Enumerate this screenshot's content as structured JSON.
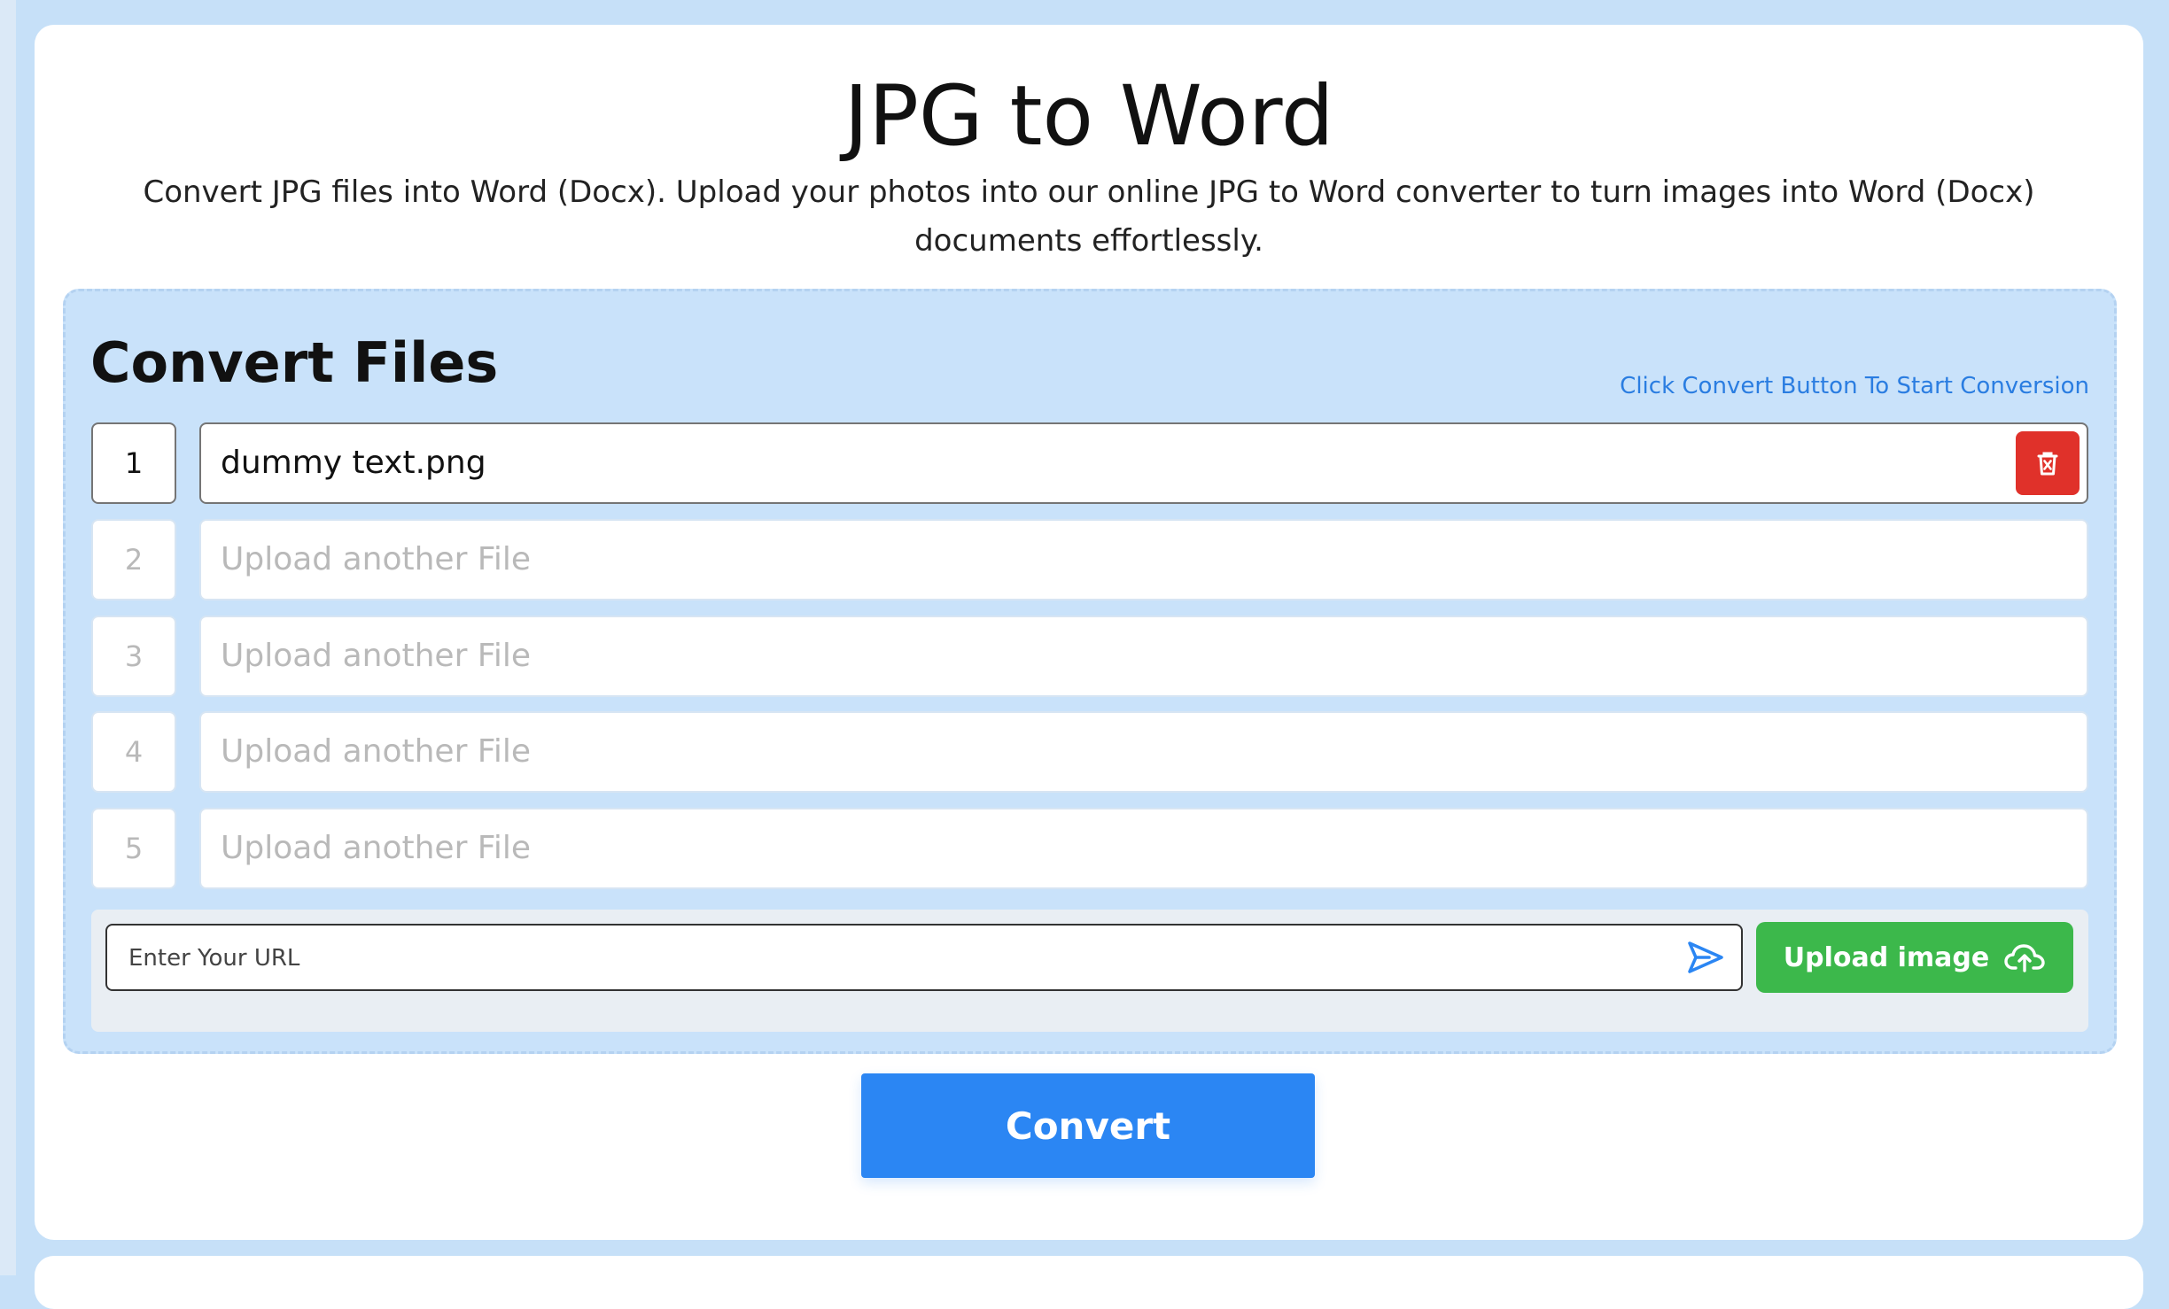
{
  "header": {
    "title": "JPG to Word",
    "subtitle": "Convert JPG files into Word (Docx). Upload your photos into our online JPG to Word converter to turn images into Word (Docx) documents effortlessly."
  },
  "panel": {
    "title": "Convert Files",
    "hint": "Click Convert Button To Start Conversion"
  },
  "files": [
    {
      "number": "1",
      "name": "dummy text.png"
    },
    {
      "number": "2",
      "placeholder": "Upload another File"
    },
    {
      "number": "3",
      "placeholder": "Upload another File"
    },
    {
      "number": "4",
      "placeholder": "Upload another File"
    },
    {
      "number": "5",
      "placeholder": "Upload another File"
    }
  ],
  "url": {
    "placeholder": "Enter Your URL"
  },
  "upload": {
    "label": "Upload image"
  },
  "convert": {
    "label": "Convert"
  },
  "colors": {
    "page_background": "#c6e0f8",
    "panel_background": "#c9e2fa",
    "accent_blue": "#2b86f3",
    "upload_green": "#3cb84b",
    "delete_red": "#e0312a"
  },
  "icons": {
    "delete": "trash-icon",
    "send": "send-icon",
    "upload": "cloud-upload-icon"
  }
}
